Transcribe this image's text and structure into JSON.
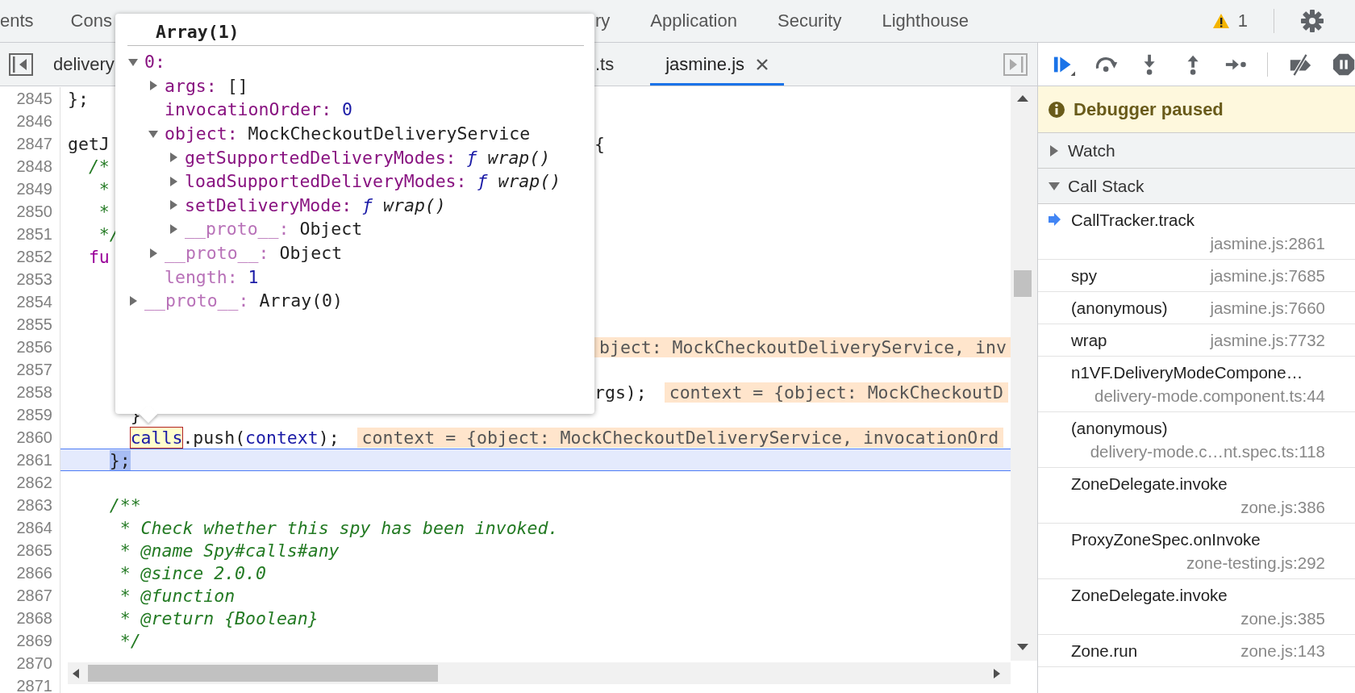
{
  "panel_tabs": [
    {
      "label": "ents",
      "selected": false
    },
    {
      "label": "Cons",
      "selected": false
    },
    {
      "label": "ry",
      "selected": false
    },
    {
      "label": "Application",
      "selected": false
    },
    {
      "label": "Security",
      "selected": false
    },
    {
      "label": "Lighthouse",
      "selected": false
    }
  ],
  "warnings": {
    "count": "1"
  },
  "file_tabs": [
    {
      "label": "delivery",
      "selected": false,
      "closable": false
    },
    {
      "label": ".ts",
      "selected": false,
      "closable": false
    },
    {
      "label": "jasmine.js",
      "selected": true,
      "closable": true
    }
  ],
  "source": {
    "lines": [
      {
        "number": "2845",
        "current": false,
        "code": [
          {
            "kind": "plain",
            "text": "};"
          }
        ]
      },
      {
        "number": "2846",
        "current": false
      },
      {
        "number": "2847",
        "current": false,
        "code": [
          {
            "kind": "plain",
            "text": "getJ"
          }
        ],
        "after_popup": [
          {
            "kind": "plain",
            "text": "{"
          }
        ]
      },
      {
        "number": "2848",
        "current": false,
        "code": [
          {
            "kind": "comment",
            "text": "  /*"
          }
        ]
      },
      {
        "number": "2849",
        "current": false,
        "code": [
          {
            "kind": "comment",
            "text": "   *"
          }
        ]
      },
      {
        "number": "2850",
        "current": false,
        "code": [
          {
            "kind": "comment",
            "text": "   *"
          }
        ]
      },
      {
        "number": "2851",
        "current": false,
        "code": [
          {
            "kind": "comment",
            "text": "   */"
          }
        ]
      },
      {
        "number": "2852",
        "current": false,
        "code": [
          {
            "kind": "keyword",
            "text": "  fu"
          }
        ]
      },
      {
        "number": "2853",
        "current": false
      },
      {
        "number": "2854",
        "current": false
      },
      {
        "number": "2855",
        "current": false
      },
      {
        "number": "2856",
        "current": false,
        "after_popup": [
          {
            "kind": "inline_value",
            "text": "bject: MockCheckoutDeliveryService, inv"
          }
        ]
      },
      {
        "number": "2857",
        "current": false
      },
      {
        "number": "2858",
        "current": false,
        "after_popup": [
          {
            "kind": "plain",
            "text": "rgs);"
          },
          {
            "kind": "inline_value",
            "text": "context = {object: MockCheckoutD"
          }
        ]
      },
      {
        "number": "2859",
        "current": false,
        "code": [
          {
            "kind": "plain",
            "text": "      }"
          }
        ]
      },
      {
        "number": "2860",
        "current": false,
        "code": [
          {
            "kind": "hover",
            "text": "      calls"
          },
          {
            "kind": "plain",
            "text": ".push("
          },
          {
            "kind": "variable",
            "text": "context"
          },
          {
            "kind": "plain",
            "text": ");"
          },
          {
            "kind": "inline_value",
            "text": "context = {object: MockCheckoutDeliveryService, invocationOrd"
          }
        ]
      },
      {
        "number": "2861",
        "current": true,
        "code": [
          {
            "kind": "paused_at",
            "text": "    };"
          }
        ]
      },
      {
        "number": "2862",
        "current": false
      },
      {
        "number": "2863",
        "current": false,
        "code": [
          {
            "kind": "comment",
            "text": "    /**"
          }
        ]
      },
      {
        "number": "2864",
        "current": false,
        "code": [
          {
            "kind": "comment",
            "text": "     * Check whether this spy has been invoked."
          }
        ]
      },
      {
        "number": "2865",
        "current": false,
        "code": [
          {
            "kind": "comment",
            "text": "     * @name Spy#calls#any"
          }
        ]
      },
      {
        "number": "2866",
        "current": false,
        "code": [
          {
            "kind": "comment",
            "text": "     * @since 2.0.0"
          }
        ]
      },
      {
        "number": "2867",
        "current": false,
        "code": [
          {
            "kind": "comment",
            "text": "     * @function"
          }
        ]
      },
      {
        "number": "2868",
        "current": false,
        "code": [
          {
            "kind": "comment",
            "text": "     * @return {Boolean}"
          }
        ]
      },
      {
        "number": "2869",
        "current": false,
        "code": [
          {
            "kind": "comment",
            "text": "     */"
          }
        ]
      },
      {
        "number": "2870",
        "current": false
      },
      {
        "number": "2871",
        "current": false
      }
    ]
  },
  "popover": {
    "title": "Array(1)",
    "tree": [
      {
        "key": "0:",
        "kind": "group",
        "expanded": true,
        "dim": false,
        "children": [
          {
            "key": "args:",
            "kind": "group",
            "expanded": false,
            "dim": false,
            "value": {
              "kind": "plain",
              "text": "[]"
            }
          },
          {
            "key": "invocationOrder:",
            "kind": "value",
            "dim": false,
            "value": {
              "kind": "number",
              "text": "0"
            }
          },
          {
            "key": "object:",
            "kind": "group",
            "expanded": true,
            "dim": false,
            "value": {
              "kind": "plain",
              "text": "MockCheckoutDeliveryService"
            },
            "children": [
              {
                "key": "getSupportedDeliveryModes:",
                "kind": "group",
                "expanded": false,
                "dim": false,
                "value": {
                  "kind": "function",
                  "keyword": "ƒ",
                  "text": "wrap()"
                }
              },
              {
                "key": "loadSupportedDeliveryModes:",
                "kind": "group",
                "expanded": false,
                "dim": false,
                "value": {
                  "kind": "function",
                  "keyword": "ƒ",
                  "text": "wrap()"
                }
              },
              {
                "key": "setDeliveryMode:",
                "kind": "group",
                "expanded": false,
                "dim": false,
                "value": {
                  "kind": "function",
                  "keyword": "ƒ",
                  "text": "wrap()"
                }
              },
              {
                "key": "__proto__:",
                "kind": "group",
                "expanded": false,
                "dim": true,
                "value": {
                  "kind": "plain",
                  "text": "Object"
                }
              }
            ]
          },
          {
            "key": "__proto__:",
            "kind": "group",
            "expanded": false,
            "dim": true,
            "value": {
              "kind": "plain",
              "text": "Object"
            }
          },
          {
            "key": "length:",
            "kind": "value",
            "dim": true,
            "value": {
              "kind": "number",
              "text": "1"
            }
          }
        ]
      },
      {
        "key": "__proto__:",
        "kind": "group",
        "expanded": false,
        "dim": true,
        "value": {
          "kind": "plain",
          "text": "Array(0)"
        }
      }
    ]
  },
  "paused_banner": {
    "text": "Debugger paused"
  },
  "sections": [
    {
      "title": "Watch",
      "expanded": false
    },
    {
      "title": "Call Stack",
      "expanded": true
    }
  ],
  "call_stack": [
    {
      "name": "CallTracker.track",
      "location": "jasmine.js:2861",
      "current": true
    },
    {
      "name": "spy",
      "location": "jasmine.js:7685",
      "current": false
    },
    {
      "name": "(anonymous)",
      "location": "jasmine.js:7660",
      "current": false
    },
    {
      "name": "wrap",
      "location": "jasmine.js:7732",
      "current": false
    },
    {
      "name": "n1VF.DeliveryModeCompone…",
      "location": "delivery-mode.component.ts:44",
      "current": false
    },
    {
      "name": "(anonymous)",
      "location": "delivery-mode.c…nt.spec.ts:118",
      "current": false
    },
    {
      "name": "ZoneDelegate.invoke",
      "location": "zone.js:386",
      "current": false
    },
    {
      "name": "ProxyZoneSpec.onInvoke",
      "location": "zone-testing.js:292",
      "current": false
    },
    {
      "name": "ZoneDelegate.invoke",
      "location": "zone.js:385",
      "current": false
    },
    {
      "name": "Zone.run",
      "location": "zone.js:143",
      "current": false
    }
  ]
}
